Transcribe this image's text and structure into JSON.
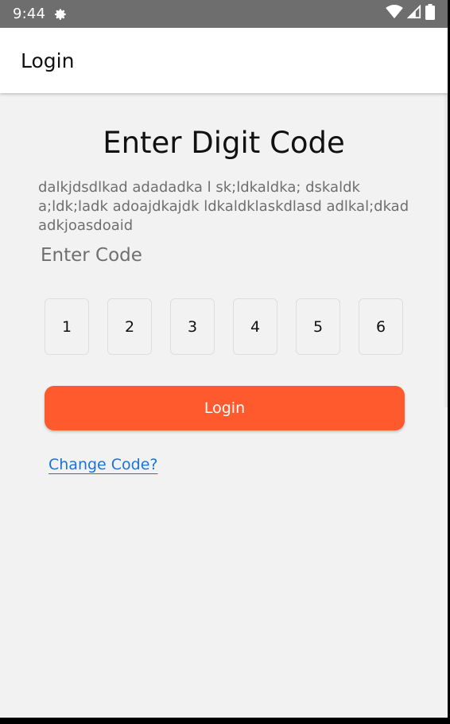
{
  "status_bar": {
    "time": "9:44",
    "icons": [
      "settings-icon",
      "wifi-icon",
      "signal-icon",
      "battery-icon"
    ]
  },
  "app_bar": {
    "title": "Login"
  },
  "main": {
    "heading": "Enter Digit Code",
    "description": "dalkjdsdlkad adadadka l sk;ldkaldka; dskaldk a;ldk;ladk adoajdkajdk ldkaldklaskdlasd adlkal;dkad adkjoasdoaid",
    "code_label": "Enter Code",
    "code_digits": [
      "1",
      "2",
      "3",
      "4",
      "5",
      "6"
    ],
    "login_button": "Login",
    "change_code_link": "Change Code?"
  },
  "colors": {
    "accent": "#ff5a2e",
    "link": "#1a73d9",
    "status_bar_bg": "#6e6e6e",
    "background": "#f2f2f2"
  }
}
